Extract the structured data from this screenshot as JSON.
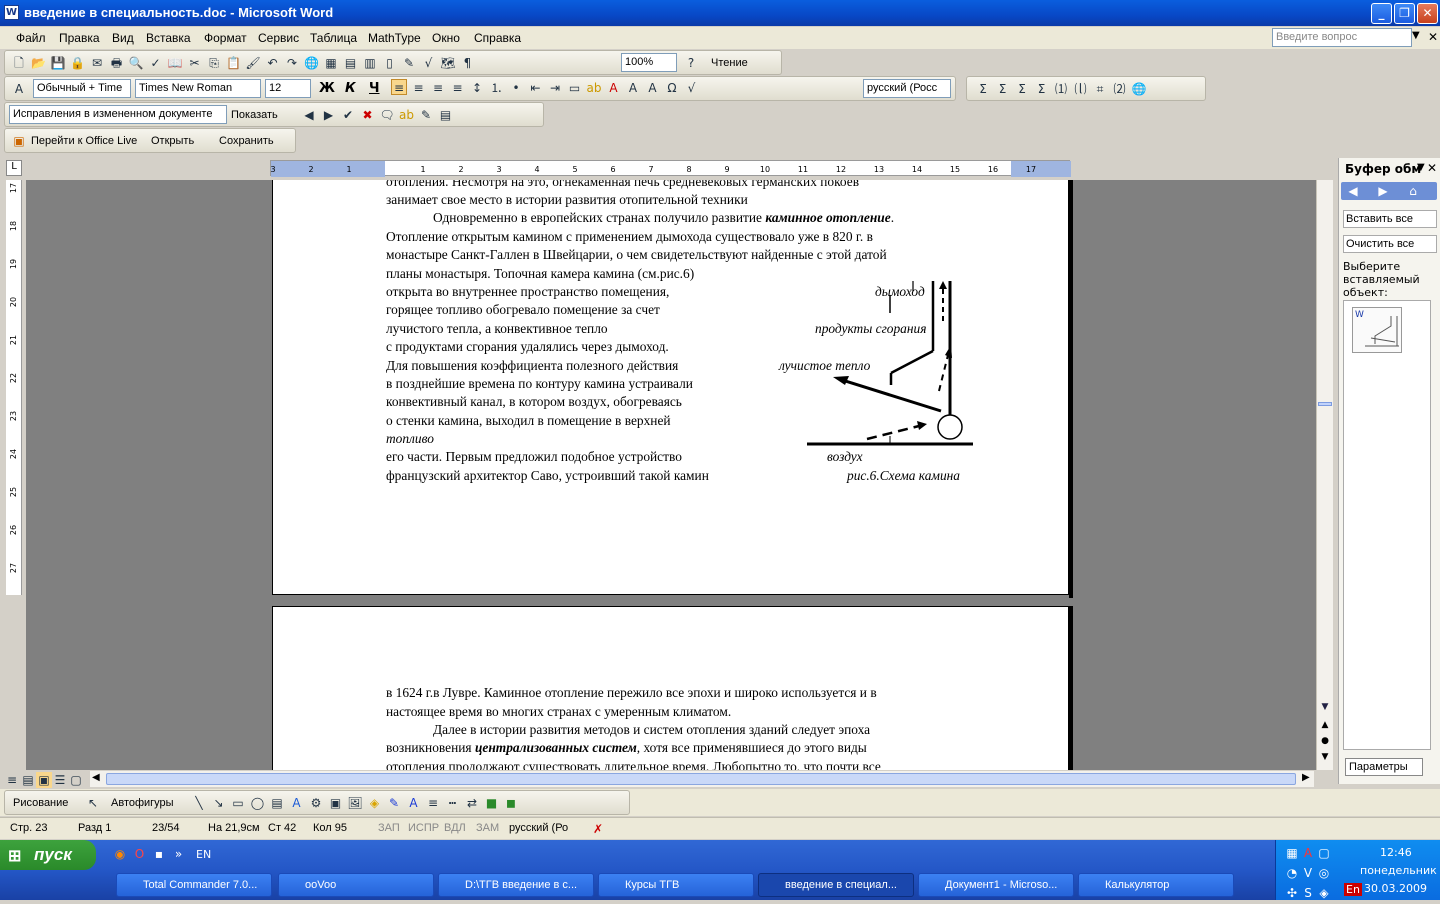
{
  "window": {
    "title": "введение в специальность.doc - Microsoft Word",
    "icon": "word-doc-icon"
  },
  "menu": [
    "Файл",
    "Правка",
    "Вид",
    "Вставка",
    "Формат",
    "Сервис",
    "Таблица",
    "MathType",
    "Окно",
    "Справка"
  ],
  "help_box": {
    "placeholder": "Введите вопрос"
  },
  "toolbar_std": {
    "zoom": "100%",
    "reading": "Чтение"
  },
  "toolbar_fmt": {
    "style": "Обычный + Time",
    "font": "Times New Roman",
    "size": "12",
    "bold": "Ж",
    "italic": "К",
    "underline": "Ч",
    "language": "русский (Росс"
  },
  "toolbar_review": {
    "mode": "Исправления в измененном документе",
    "show": "Показать"
  },
  "toolbar_live": {
    "goto": "Перейти к Office Live",
    "open": "Открыть",
    "save": "Сохранить"
  },
  "page1": {
    "lines": [
      "отопления. Несмотря на это, огнекаменная печь средневековых германских покоев",
      "занимает свое место в истории развития отопительной техники"
    ],
    "para2_start": "Одновременно в европейских странах получило развитие ",
    "para2_bold": "каминное отопление",
    "para2_end": ".",
    "lines2": [
      "Отопление открытым камином с применением дымохода существовало уже в 820 г. в",
      "монастыре Санкт-Галлен в Швейцарии, о чем свидетельствуют найденные с этой датой",
      "планы монастыря. Топочная камера камина (см.рис.6)",
      "открыта во внутреннее пространство помещения,",
      "горящее топливо обогревало помещение за счет",
      " лучистого тепла, а конвективное тепло",
      "с продуктами сгорания удалялись через дымоход.",
      " Для повышения коэффициента полезного действия",
      "в позднейшие времена по контуру камина устраивали",
      "конвективный канал, в котором  воздух, обогреваясь",
      " о стенки камина, выходил в помещение в верхней",
      "его части. Первым  предложил подобное устройство",
      "французский архитектор Саво, устроивший такой камин"
    ],
    "figure": {
      "chimney": "дымоход",
      "products": "продукты сгорания",
      "radiant": "лучистое тепло",
      "fuel": "топливо",
      "air": "воздух",
      "caption": "рис.6.Схема камина"
    }
  },
  "page2": {
    "lines": [
      "в 1624 г.в Лувре. Каминное отопление пережило  все эпохи и широко используется и в",
      "настоящее время  во многих странах с умеренным    климатом."
    ],
    "para_start": "Далее в истории развития методов и систем отопления зданий следует эпоха",
    "line_b1": "возникновения ",
    "line_b_bold": "централизованных систем",
    "line_b2": ", хотя все применявшиеся до этого виды",
    "line_c": "отопления продолжают существовать длительное время. Любопытно то, что почти все"
  },
  "taskpane": {
    "title": "Буфер обм",
    "paste_all": "Вставить все",
    "clear_all": "Очистить все",
    "hint": "Выберите вставляемый объект:",
    "options": "Параметры"
  },
  "drawbar": {
    "draw": "Рисование",
    "autoshapes": "Автофигуры"
  },
  "status": {
    "page": "Стр. 23",
    "section": "Разд  1",
    "pages": "23/54",
    "at": "На 21,9см",
    "line": "Ст 42",
    "col": "Кол 95",
    "rec": "ЗАП",
    "trk": "ИСПР",
    "ext": "ВДЛ",
    "ovr": "ЗАМ",
    "lang": "русский (Ро"
  },
  "taskbar": {
    "start": "пуск",
    "lang": "EN",
    "tasks": [
      "Total Commander 7.0...",
      "ooVoo",
      "D:\\ТГВ введение в с...",
      "Курсы ТГВ",
      "введение в специал...",
      "Документ1 - Microso...",
      "Калькулятор"
    ],
    "clock": {
      "time": "12:46",
      "day": "понедельник",
      "date": "30.03.2009"
    },
    "tray_lang": "En"
  },
  "hruler_ticks": [
    "3",
    "2",
    "1",
    "1",
    "2",
    "3",
    "4",
    "5",
    "6",
    "7",
    "8",
    "9",
    "10",
    "11",
    "12",
    "13",
    "14",
    "15",
    "16",
    "17"
  ],
  "vruler_ticks": [
    "17",
    "18",
    "19",
    "20",
    "21",
    "22",
    "23",
    "24",
    "25",
    "26",
    "27"
  ]
}
